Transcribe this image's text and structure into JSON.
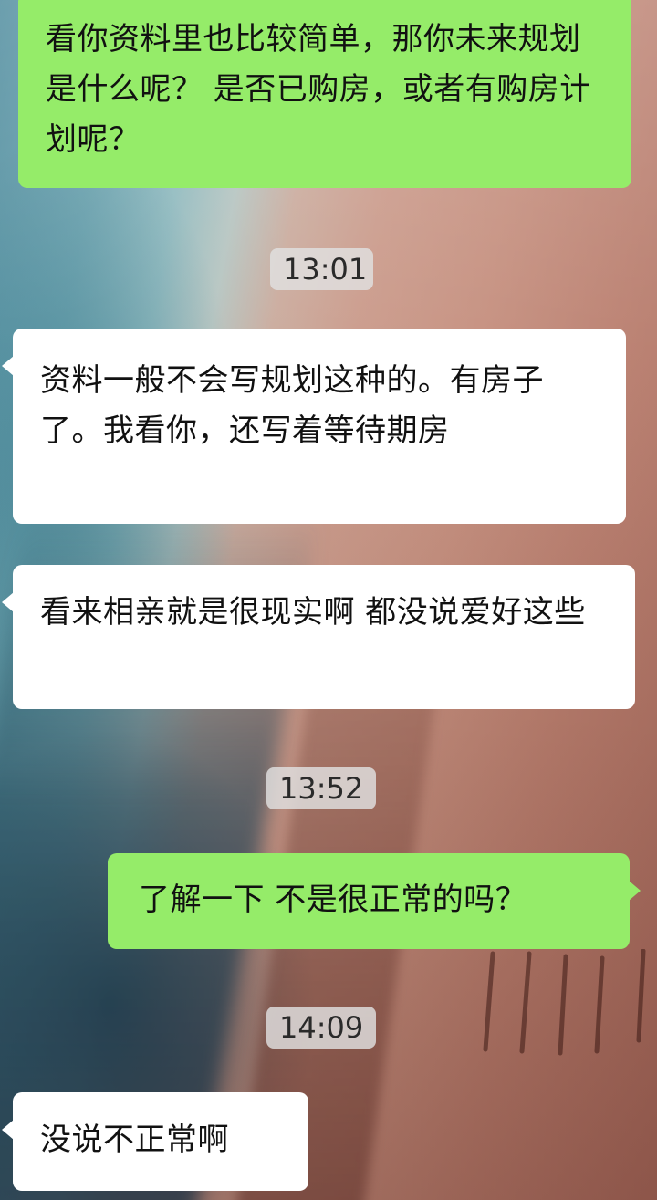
{
  "messages": [
    {
      "side": "out",
      "text": "看你资料里也比较简单，那你未来规划是什么呢？ 是否已购房，或者有购房计划呢？"
    },
    {
      "type": "time",
      "text": "13:01"
    },
    {
      "side": "in",
      "text": "资料一般不会写规划这种的。有房子了。我看你，还写着等待期房"
    },
    {
      "side": "in",
      "text": "看来相亲就是很现实啊 都没说爱好这些"
    },
    {
      "type": "time",
      "text": "13:52"
    },
    {
      "side": "out",
      "text": "了解一下 不是很正常的吗？"
    },
    {
      "type": "time",
      "text": "14:09"
    },
    {
      "side": "in",
      "text": "没说不正常啊"
    }
  ],
  "colors": {
    "outgoing_bubble": "#95ec69",
    "incoming_bubble": "#ffffff",
    "timestamp_bg": "#e1e1e1"
  }
}
